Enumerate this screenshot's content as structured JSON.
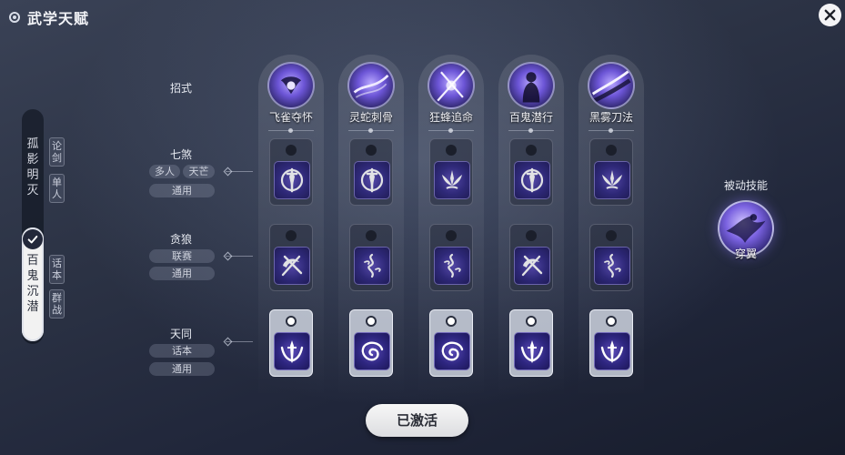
{
  "header": {
    "title": "武学天赋"
  },
  "left_nav": {
    "tabs": [
      {
        "label": [
          "孤",
          "影",
          "明",
          "灭"
        ],
        "tags": [
          [
            "论",
            "剑"
          ],
          [
            "单",
            "人"
          ]
        ]
      },
      {
        "label": [
          "百",
          "鬼",
          "沉",
          "潜"
        ],
        "tags": [
          [
            "话",
            "本"
          ],
          [
            "群",
            "战"
          ]
        ],
        "selected": true
      }
    ]
  },
  "rows": [
    {
      "title": "招式"
    },
    {
      "title": "七煞",
      "tags": [
        "多人",
        "天芒",
        "通用"
      ]
    },
    {
      "title": "贪狼",
      "tags": [
        "联赛",
        "通用"
      ]
    },
    {
      "title": "天同",
      "tags": [
        "话本",
        "通用"
      ],
      "active": true
    }
  ],
  "skills": [
    "飞雀夺怀",
    "灵蛇刺骨",
    "狂蜂追命",
    "百鬼潜行",
    "黑雾刀法"
  ],
  "talent_icons": {
    "qisha": [
      "sword-shield-icon",
      "sword-shield-icon",
      "lotus-icon",
      "sword-shield-icon",
      "lotus-icon"
    ],
    "tanlang": [
      "crossed-blades-icon",
      "whirlwind-icon",
      "whirlwind-icon",
      "crossed-blades-icon",
      "whirlwind-icon"
    ],
    "tiantong": [
      "sword-wings-icon",
      "vortex-icon",
      "vortex-icon",
      "sword-wings-icon",
      "sword-wings-icon"
    ]
  },
  "passive": {
    "title": "被动技能",
    "name": "穿翼"
  },
  "footer": {
    "button": "已激活"
  },
  "colors": {
    "accent": "#6c55d6",
    "panel": "#2b3244"
  }
}
